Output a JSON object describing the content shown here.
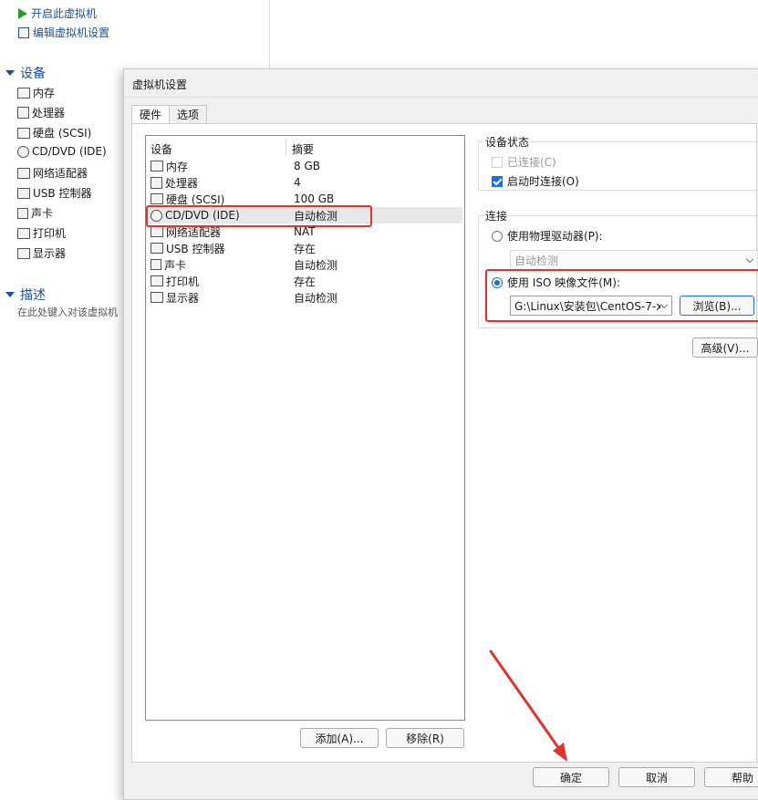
{
  "background": {
    "actions": [
      {
        "label": "开启此虚拟机",
        "icon": "play-icon"
      },
      {
        "label": "编辑虚拟机设置",
        "icon": "edit-icon"
      }
    ],
    "devices_section": "设备",
    "devices": [
      {
        "label": "内存",
        "icon": "memory-icon"
      },
      {
        "label": "处理器",
        "icon": "cpu-icon"
      },
      {
        "label": "硬盘 (SCSI)",
        "icon": "harddisk-icon"
      },
      {
        "label": "CD/DVD (IDE)",
        "icon": "cd-icon"
      },
      {
        "label": "网络适配器",
        "icon": "network-icon"
      },
      {
        "label": "USB 控制器",
        "icon": "usb-icon"
      },
      {
        "label": "声卡",
        "icon": "sound-icon"
      },
      {
        "label": "打印机",
        "icon": "printer-icon"
      },
      {
        "label": "显示器",
        "icon": "display-icon"
      }
    ],
    "desc_section": "描述",
    "desc_placeholder": "在此处键入对该虚拟机"
  },
  "dialog": {
    "title": "虚拟机设置",
    "tabs": [
      {
        "label": "硬件"
      },
      {
        "label": "选项"
      }
    ],
    "table_headers": {
      "device": "设备",
      "summary": "摘要"
    },
    "rows": [
      {
        "device": "内存",
        "summary": "8 GB",
        "icon": "memory-icon"
      },
      {
        "device": "处理器",
        "summary": "4",
        "icon": "cpu-icon"
      },
      {
        "device": "硬盘 (SCSI)",
        "summary": "100 GB",
        "icon": "harddisk-icon"
      },
      {
        "device": "CD/DVD (IDE)",
        "summary": "自动检测",
        "icon": "cd-icon"
      },
      {
        "device": "网络适配器",
        "summary": "NAT",
        "icon": "network-icon"
      },
      {
        "device": "USB 控制器",
        "summary": "存在",
        "icon": "usb-icon"
      },
      {
        "device": "声卡",
        "summary": "自动检测",
        "icon": "sound-icon"
      },
      {
        "device": "打印机",
        "summary": "存在",
        "icon": "printer-icon"
      },
      {
        "device": "显示器",
        "summary": "自动检测",
        "icon": "display-icon"
      }
    ],
    "add_button": "添加(A)...",
    "remove_button": "移除(R)",
    "device_status": {
      "label": "设备状态",
      "connected": "已连接(C)",
      "connect_on_power_on": "启动时连接(O)"
    },
    "connection": {
      "label": "连接",
      "physical_drive": "使用物理驱动器(P):",
      "physical_drive_value": "自动检测",
      "iso_image": "使用 ISO 映像文件(M):",
      "iso_path": "G:\\Linux\\安装包\\CentOS-7-x",
      "browse_button": "浏览(B)..."
    },
    "advanced_button": "高级(V)...",
    "ok_button": "确定",
    "cancel_button": "取消",
    "help_button": "帮助"
  },
  "colors": {
    "highlight": "#e0342e",
    "accent": "#1d6ed8"
  }
}
